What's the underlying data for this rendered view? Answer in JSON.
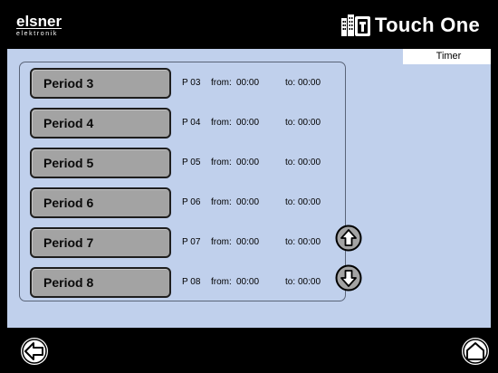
{
  "header": {
    "logo_main": "elsner",
    "logo_sub": "elektronik",
    "brand_title": "Touch One"
  },
  "tab": {
    "label": "Timer"
  },
  "periods": [
    {
      "label": "Period 3",
      "code": "P 03",
      "from_label": "from:",
      "from_value": "00:00",
      "to_label": "to:",
      "to_value": "00:00"
    },
    {
      "label": "Period 4",
      "code": "P 04",
      "from_label": "from:",
      "from_value": "00:00",
      "to_label": "to:",
      "to_value": "00:00"
    },
    {
      "label": "Period 5",
      "code": "P 05",
      "from_label": "from:",
      "from_value": "00:00",
      "to_label": "to:",
      "to_value": "00:00"
    },
    {
      "label": "Period 6",
      "code": "P 06",
      "from_label": "from:",
      "from_value": "00:00",
      "to_label": "to:",
      "to_value": "00:00"
    },
    {
      "label": "Period 7",
      "code": "P 07",
      "from_label": "from:",
      "from_value": "00:00",
      "to_label": "to:",
      "to_value": "00:00"
    },
    {
      "label": "Period 8",
      "code": "P 08",
      "from_label": "from:",
      "from_value": "00:00",
      "to_label": "to:",
      "to_value": "00:00"
    }
  ],
  "icons": {
    "scroll_up": "arrow-up-icon",
    "scroll_down": "arrow-down-icon",
    "back": "arrow-left-icon",
    "home": "home-icon",
    "brand": "building-icon"
  },
  "colors": {
    "background": "#000000",
    "panel": "#c0d0ec",
    "button": "#a3a3a3",
    "tab": "#ffffff"
  }
}
